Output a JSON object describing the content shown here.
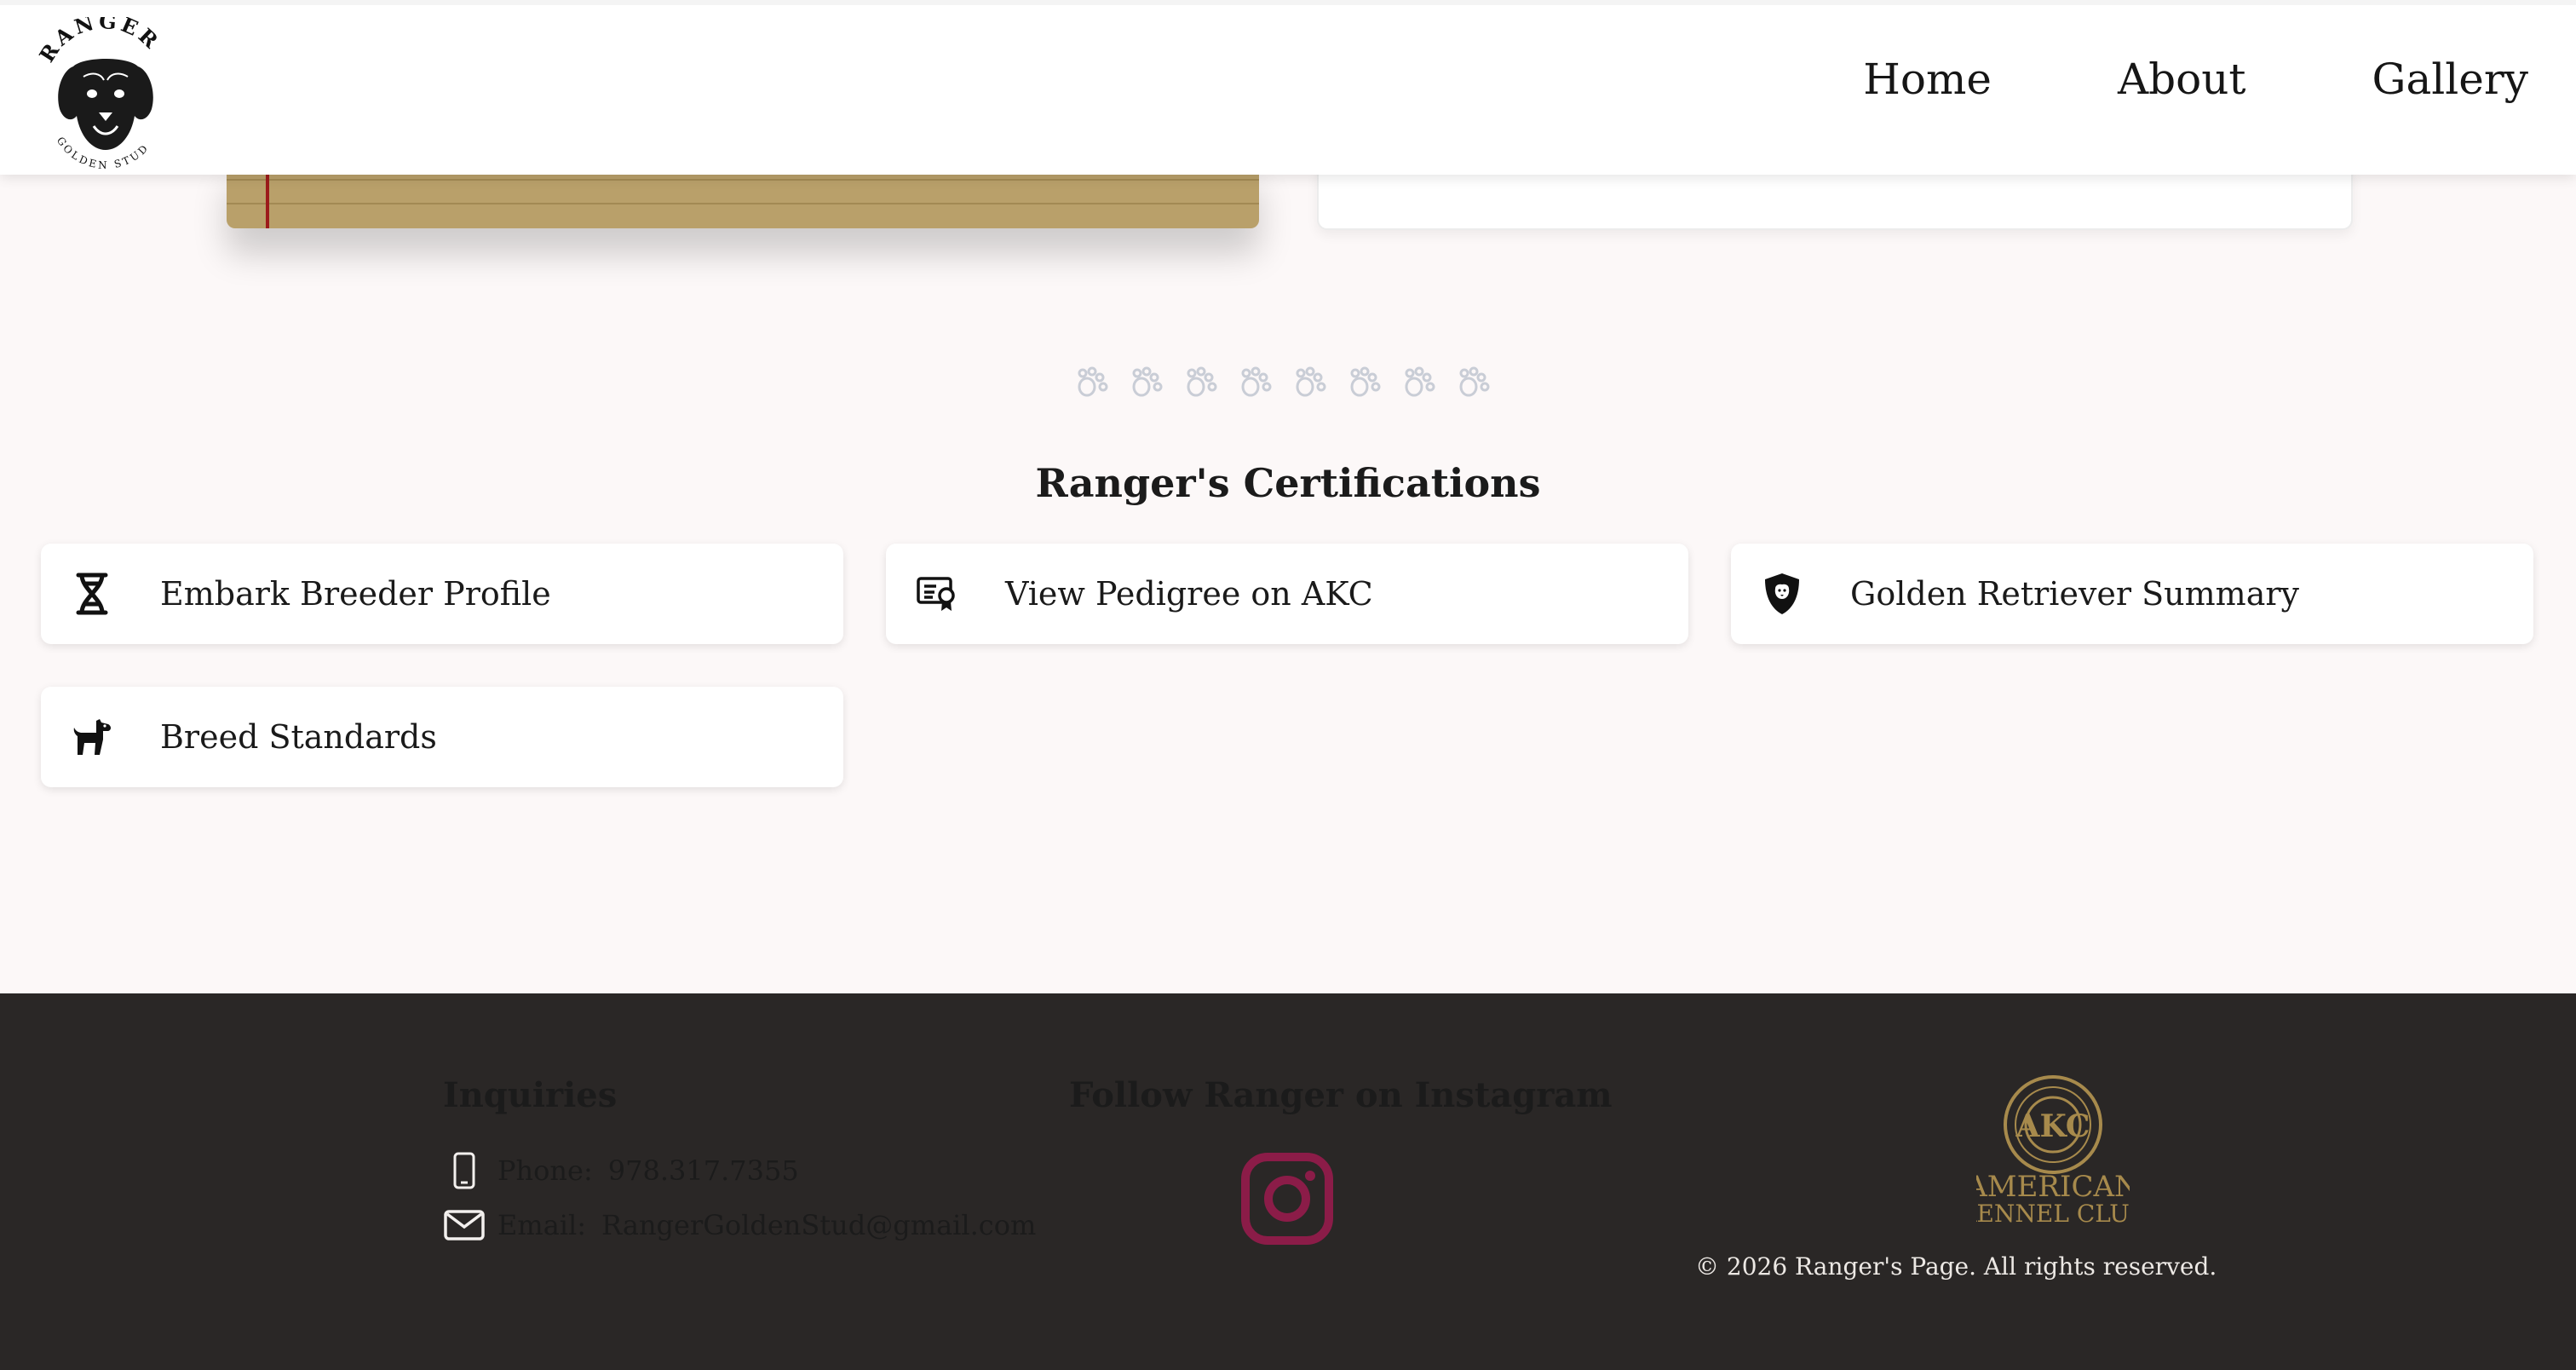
{
  "header": {
    "logo_text_top": "RANGER",
    "logo_text_bottom": "GOLDEN STUD",
    "nav": [
      "Home",
      "About",
      "Gallery"
    ]
  },
  "certifications": {
    "title": "Ranger's Certifications",
    "items": [
      {
        "label": "Embark Breeder Profile",
        "icon": "dna-icon"
      },
      {
        "label": "View Pedigree on AKC",
        "icon": "certificate-icon"
      },
      {
        "label": "Golden Retriever Summary",
        "icon": "shield-dog-icon"
      },
      {
        "label": "Breed Standards",
        "icon": "dog-icon"
      }
    ]
  },
  "footer": {
    "inquiries_title": "Inquiries",
    "phone_label": "Phone:",
    "phone_value": "978.317.7355",
    "email_label": "Email:",
    "email_value": "RangerGoldenStud@gmail.com",
    "instagram_title": "Follow Ranger on Instagram",
    "akc_logo_text": "AMERICAN KENNEL CLUB",
    "copyright": "© 2026 Ranger's Page. All rights reserved."
  },
  "colors": {
    "instagram": "#8b1c48",
    "akc_gold": "#a78a4c",
    "footer_bg": "#2a2726",
    "notebook": "#b9a06a"
  }
}
